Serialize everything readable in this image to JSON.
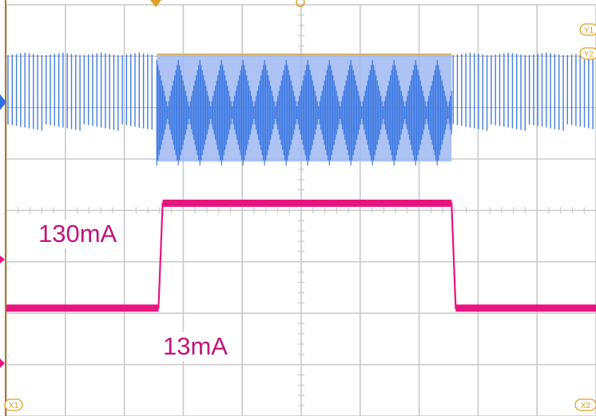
{
  "chart_data": {
    "type": "line",
    "title": "",
    "xlabel": "",
    "ylabel": "",
    "grid": true,
    "grid_divisions": {
      "x": 10,
      "y": 8
    },
    "series": [
      {
        "name": "",
        "kind": "modulated-carrier",
        "color": "#2f6fdf",
        "segments": [
          {
            "x_start_div": 0.0,
            "x_end_div": 2.55,
            "state": "idle",
            "envelope_div": [
              0.9,
              2.45
            ]
          },
          {
            "x_start_div": 2.55,
            "x_end_div": 7.55,
            "state": "burst",
            "envelope_div": [
              0.9,
              3.05
            ]
          },
          {
            "x_start_div": 7.55,
            "x_end_div": 10.0,
            "state": "idle",
            "envelope_div": [
              0.9,
              2.45
            ]
          }
        ]
      },
      {
        "name": "",
        "kind": "current",
        "color": "#e6157f",
        "points_div": [
          [
            0.0,
            5.9
          ],
          [
            2.58,
            5.9
          ],
          [
            2.65,
            3.86
          ],
          [
            7.55,
            3.86
          ],
          [
            7.62,
            5.9
          ],
          [
            10.0,
            5.9
          ]
        ]
      }
    ],
    "annotations": [
      {
        "text": "130mA"
      },
      {
        "text": "13mA"
      }
    ],
    "markers": {
      "x1": "X1",
      "x2": "X2",
      "y1": "Y1",
      "y2": "Y2"
    },
    "colors": {
      "background": "#ffffff",
      "grid": "#c9c9c9",
      "label": "#c0157a",
      "marker": "#e0a020"
    }
  }
}
